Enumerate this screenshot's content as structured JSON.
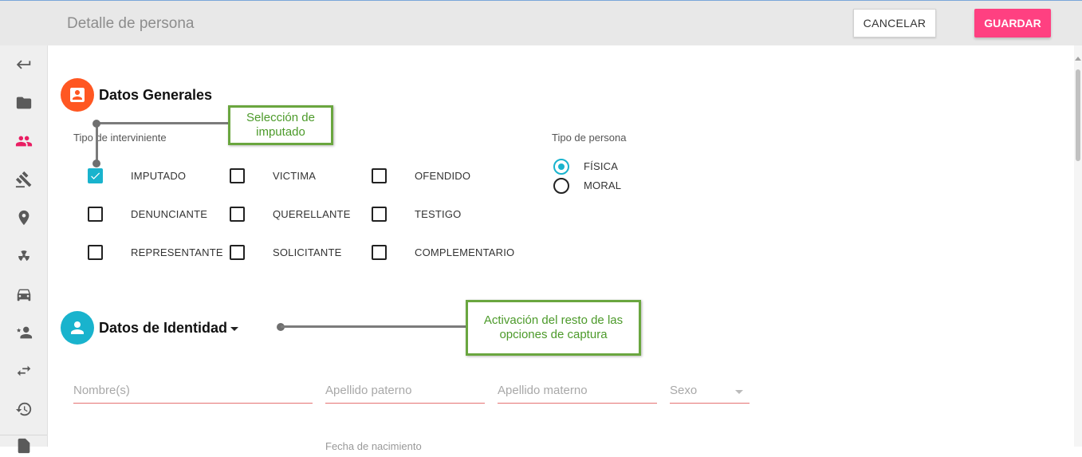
{
  "header": {
    "title": "Detalle de persona",
    "cancel_label": "CANCELAR",
    "save_label": "GUARDAR"
  },
  "sidebar": {
    "items": [
      {
        "icon": "back-arrow-icon"
      },
      {
        "icon": "folder-icon"
      },
      {
        "icon": "people-icon",
        "active": true,
        "color": "#e91e63"
      },
      {
        "icon": "gavel-icon"
      },
      {
        "icon": "location-pin-icon"
      },
      {
        "icon": "radioactive-icon"
      },
      {
        "icon": "car-icon"
      },
      {
        "icon": "person-star-icon"
      },
      {
        "icon": "swap-arrows-icon"
      },
      {
        "icon": "history-icon"
      },
      {
        "icon": "document-icon"
      }
    ]
  },
  "datos_generales": {
    "title": "Datos Generales",
    "icon_color": "#ff5722",
    "tipo_interviniente_label": "Tipo de interviniente",
    "checkboxes": [
      {
        "label": "IMPUTADO",
        "checked": true
      },
      {
        "label": "VICTIMA",
        "checked": false
      },
      {
        "label": "OFENDIDO",
        "checked": false
      },
      {
        "label": "DENUNCIANTE",
        "checked": false
      },
      {
        "label": "QUERELLANTE",
        "checked": false
      },
      {
        "label": "TESTIGO",
        "checked": false
      },
      {
        "label": "REPRESENTANTE",
        "checked": false
      },
      {
        "label": "SOLICITANTE",
        "checked": false
      },
      {
        "label": "COMPLEMENTARIO",
        "checked": false
      }
    ],
    "tipo_persona_label": "Tipo de persona",
    "radios": [
      {
        "label": "FÍSICA",
        "checked": true
      },
      {
        "label": "MORAL",
        "checked": false
      }
    ]
  },
  "datos_identidad": {
    "title": "Datos de Identidad",
    "icon_color": "#19b3cd",
    "fields": {
      "nombres": {
        "placeholder": "Nombre(s)"
      },
      "apellido_paterno": {
        "placeholder": "Apellido paterno"
      },
      "apellido_materno": {
        "placeholder": "Apellido materno"
      },
      "sexo": {
        "placeholder": "Sexo"
      }
    },
    "partial_label": "Fecha de nacimiento"
  },
  "annotations": {
    "callout_1": "Selección de imputado",
    "callout_2": "Activación del resto de las opciones de captura"
  },
  "colors": {
    "accent": "#19b3cd",
    "save": "#ff4081",
    "callout_border": "#6aa63f",
    "field_underline": "#e57373"
  }
}
